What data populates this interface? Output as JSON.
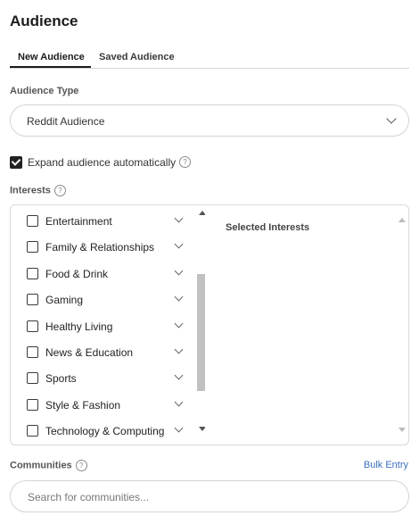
{
  "page": {
    "title": "Audience"
  },
  "tabs": [
    {
      "label": "New Audience",
      "active": true
    },
    {
      "label": "Saved Audience",
      "active": false
    }
  ],
  "audience_type": {
    "label": "Audience Type",
    "value": "Reddit Audience"
  },
  "expand": {
    "label": "Expand audience automatically",
    "checked": true
  },
  "interests": {
    "label": "Interests",
    "items": [
      {
        "label": "Entertainment",
        "checked": false
      },
      {
        "label": "Family & Relationships",
        "checked": false
      },
      {
        "label": "Food & Drink",
        "checked": false
      },
      {
        "label": "Gaming",
        "checked": false
      },
      {
        "label": "Healthy Living",
        "checked": false
      },
      {
        "label": "News & Education",
        "checked": false
      },
      {
        "label": "Sports",
        "checked": false
      },
      {
        "label": "Style & Fashion",
        "checked": false
      },
      {
        "label": "Technology & Computing",
        "checked": false
      }
    ],
    "selected_title": "Selected Interests"
  },
  "communities": {
    "label": "Communities",
    "bulk_entry": "Bulk Entry",
    "search_placeholder": "Search for communities..."
  },
  "help_glyph": "?"
}
